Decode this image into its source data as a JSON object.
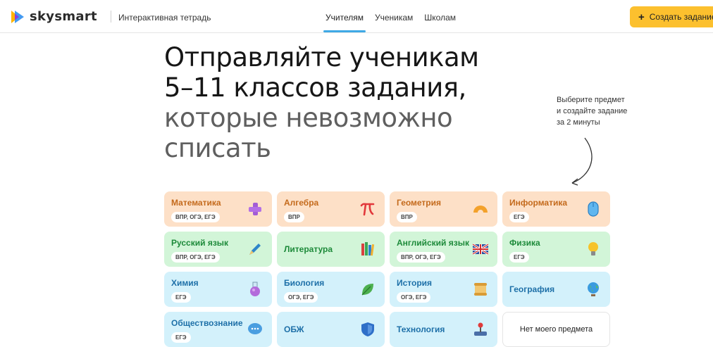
{
  "header": {
    "brand": "skysmart",
    "product": "Интерактивная тетрадь",
    "nav": [
      "Учителям",
      "Ученикам",
      "Школам"
    ],
    "cta": "Создать задание"
  },
  "hero": {
    "line1": "Отправляйте ученикам",
    "line2": "5–11 классов задания,",
    "line3": "которые невозможно",
    "line4": "списать"
  },
  "hint": {
    "line1": "Выберите предмет",
    "line2": "и создайте задание",
    "line3": "за 2 минуты"
  },
  "subjects": [
    {
      "title": "Математика",
      "tags": "ВПР, ОГЭ, ЕГЭ",
      "icon": "plus-icon"
    },
    {
      "title": "Алгебра",
      "tags": "ВПР",
      "icon": "pi-icon"
    },
    {
      "title": "Геометрия",
      "tags": "ВПР",
      "icon": "protractor-icon"
    },
    {
      "title": "Информатика",
      "tags": "ЕГЭ",
      "icon": "mouse-icon"
    },
    {
      "title": "Русский язык",
      "tags": "ВПР, ОГЭ, ЕГЭ",
      "icon": "pen-icon"
    },
    {
      "title": "Литература",
      "tags": "",
      "icon": "books-icon"
    },
    {
      "title": "Английский язык",
      "tags": "ВПР, ОГЭ, ЕГЭ",
      "icon": "uk-flag-icon"
    },
    {
      "title": "Физика",
      "tags": "ЕГЭ",
      "icon": "lightbulb-icon"
    },
    {
      "title": "Химия",
      "tags": "ЕГЭ",
      "icon": "flask-icon"
    },
    {
      "title": "Биология",
      "tags": "ОГЭ, ЕГЭ",
      "icon": "leaf-icon"
    },
    {
      "title": "История",
      "tags": "ОГЭ, ЕГЭ",
      "icon": "scroll-icon"
    },
    {
      "title": "География",
      "tags": "",
      "icon": "globe-icon"
    },
    {
      "title": "Обществознание",
      "tags": "ЕГЭ",
      "icon": "chat-icon"
    },
    {
      "title": "ОБЖ",
      "tags": "",
      "icon": "shield-icon"
    },
    {
      "title": "Технология",
      "tags": "",
      "icon": "joystick-icon"
    },
    {
      "title": "Нет моего предмета",
      "tags": "",
      "icon": ""
    }
  ]
}
